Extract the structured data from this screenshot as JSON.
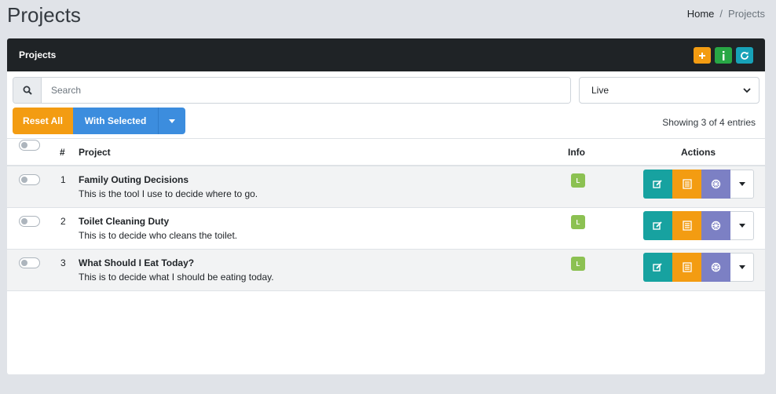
{
  "page": {
    "title": "Projects"
  },
  "breadcrumb": {
    "home": "Home",
    "separator": "/",
    "current": "Projects"
  },
  "card": {
    "title": "Projects",
    "tools": [
      {
        "icon": "plus-icon",
        "glyph": "+",
        "color": "#f39c12"
      },
      {
        "icon": "info-icon",
        "glyph": "i",
        "color": "#28a745"
      },
      {
        "icon": "refresh-icon",
        "glyph": "↻",
        "color": "#17a2b8"
      }
    ]
  },
  "search": {
    "placeholder": "Search",
    "value": ""
  },
  "status_filter": {
    "selected": "Live"
  },
  "toolbar": {
    "reset_label": "Reset All",
    "with_selected_label": "With Selected"
  },
  "entries_info": "Showing 3 of 4 entries",
  "table": {
    "headers": {
      "number": "#",
      "project": "Project",
      "info": "Info",
      "actions": "Actions"
    },
    "rows": [
      {
        "number": "1",
        "name": "Family Outing Decisions",
        "description": "This is the tool I use to decide where to go.",
        "badge": "L"
      },
      {
        "number": "2",
        "name": "Toilet Cleaning Duty",
        "description": "This is to decide who cleans the toilet.",
        "badge": "L"
      },
      {
        "number": "3",
        "name": "What Should I Eat Today?",
        "description": "This is to decide what I should be eating today.",
        "badge": "L"
      }
    ]
  },
  "colors": {
    "header_bg": "#1f2326",
    "reset": "#f39c12",
    "with_selected": "#3c8dde",
    "badge": "#8cc152",
    "action_edit": "#17a2a0",
    "action_list": "#f39c12",
    "action_wheel": "#7c80c4"
  }
}
